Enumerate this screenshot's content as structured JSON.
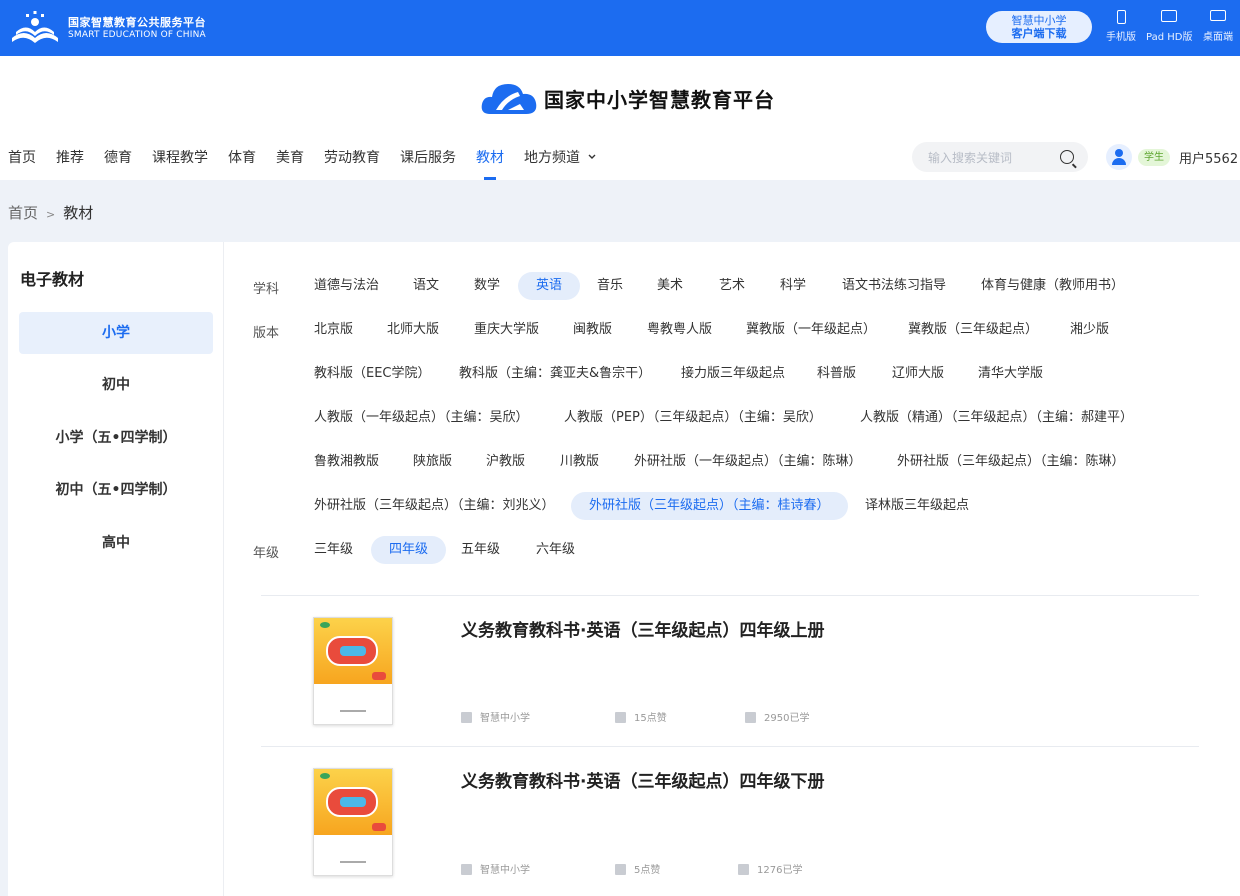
{
  "topbar": {
    "org_cn": "国家智慧教育公共服务平台",
    "org_en": "SMART EDUCATION OF CHINA",
    "download_line1": "智慧中小学",
    "download_line2": "客户端下载",
    "devices": [
      "手机版",
      "Pad HD版",
      "桌面端"
    ]
  },
  "header": {
    "brand": "国家中小学智慧教育平台",
    "nav": [
      "首页",
      "推荐",
      "德育",
      "课程教学",
      "体育",
      "美育",
      "劳动教育",
      "课后服务",
      "教材",
      "地方频道"
    ],
    "nav_active": "教材",
    "search_placeholder": "输入搜索关键词",
    "role": "学生",
    "username": "用户5562"
  },
  "breadcrumb": {
    "home": "首页",
    "sep": ">",
    "current": "教材"
  },
  "sidebar": {
    "title": "电子教材",
    "items": [
      "小学",
      "初中",
      "小学（五•四学制）",
      "初中（五•四学制）",
      "高中"
    ],
    "active": "小学"
  },
  "filters": {
    "subject_label": "学科",
    "subjects": [
      "道德与法治",
      "语文",
      "数学",
      "英语",
      "音乐",
      "美术",
      "艺术",
      "科学",
      "语文书法练习指导",
      "体育与健康（教师用书）"
    ],
    "subject_active": "英语",
    "edition_label": "版本",
    "editions": [
      "北京版",
      "北师大版",
      "重庆大学版",
      "闽教版",
      "粤教粤人版",
      "冀教版（一年级起点）",
      "冀教版（三年级起点）",
      "湘少版",
      "教科版（EEC学院）",
      "教科版（主编：龚亚夫&鲁宗干）",
      "接力版三年级起点",
      "科普版",
      "辽师大版",
      "清华大学版",
      "人教版（一年级起点）（主编：吴欣）",
      "人教版（PEP）（三年级起点）（主编：吴欣）",
      "人教版（精通）（三年级起点）（主编：郝建平）",
      "鲁教湘教版",
      "陕旅版",
      "沪教版",
      "川教版",
      "外研社版（一年级起点）（主编：陈琳）",
      "外研社版（三年级起点）（主编：陈琳）",
      "外研社版（三年级起点）（主编：刘兆义）",
      "外研社版（三年级起点）（主编：桂诗春）",
      "译林版三年级起点"
    ],
    "edition_active": "外研社版（三年级起点）（主编：桂诗春）",
    "grade_label": "年级",
    "grades": [
      "三年级",
      "四年级",
      "五年级",
      "六年级"
    ],
    "grade_active": "四年级"
  },
  "books": [
    {
      "title": "义务教育教科书·英语（三年级起点）四年级上册",
      "publisher": "智慧中小学",
      "likes": "15点赞",
      "learners": "2950已学"
    },
    {
      "title": "义务教育教科书·英语（三年级起点）四年级下册",
      "publisher": "智慧中小学",
      "likes": "5点赞",
      "learners": "1276已学"
    }
  ],
  "colors": {
    "primary": "#1c6cf0",
    "active_bg": "#e4edfb",
    "role_green": "#5fa632"
  },
  "icons": [
    "book-logo-icon",
    "cloud-logo-icon",
    "search-icon",
    "chevron-down-icon",
    "phone-icon",
    "pad-icon",
    "desktop-icon",
    "user-icon",
    "publisher-icon",
    "like-icon",
    "learned-icon"
  ]
}
